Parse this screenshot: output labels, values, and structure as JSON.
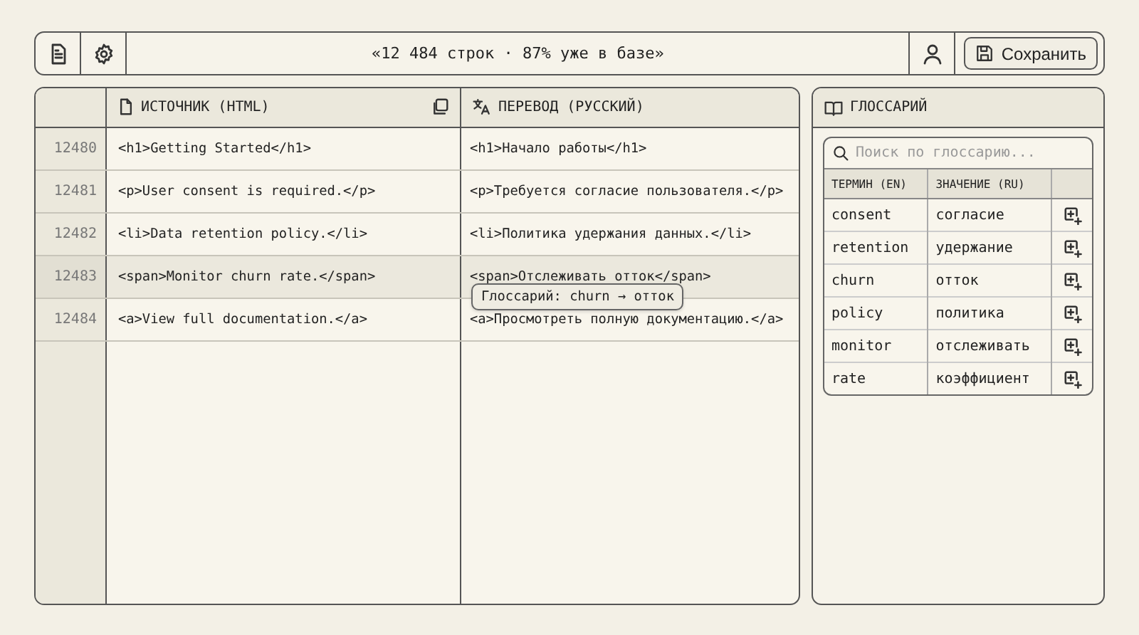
{
  "toolbar": {
    "summary": "«12 484 строк · 87% уже в базе»",
    "save_button": "Сохранить"
  },
  "editor": {
    "columns": [
      "ИСТОЧНИК (HTML)",
      "ПЕРЕВОД (РУССКИЙ)"
    ],
    "rows": [
      {
        "line": "12480",
        "source": "<h1>Getting Started</h1>",
        "translation": "<h1>Начало работы</h1>",
        "selected": false
      },
      {
        "line": "12481",
        "source": "<p>User consent is required.</p>",
        "translation": "<p>Требуется согласие пользователя.</p>",
        "selected": false
      },
      {
        "line": "12482",
        "source": "<li>Data retention policy.</li>",
        "translation": "<li>Политика удержания данных.</li>",
        "selected": false
      },
      {
        "line": "12483",
        "source": "<span>Monitor churn rate.</span>",
        "translation": "<span>Отслеживать отток</span>",
        "selected": true
      },
      {
        "line": "12484",
        "source": "<a>View full documentation.</a>",
        "translation": "<a>Просмотреть полную документацию.</a>",
        "selected": false
      }
    ],
    "tooltip": "Глоссарий: churn → отток"
  },
  "glossary": {
    "title": "ГЛОССАРИЙ",
    "search": {
      "placeholder": "Поиск по глоссарию..."
    },
    "columns": [
      "ТЕРМИН (EN)",
      "ЗНАЧЕНИЕ (RU)"
    ],
    "rows": [
      {
        "term": "consent",
        "meaning": "согласие"
      },
      {
        "term": "retention",
        "meaning": "удержание"
      },
      {
        "term": "churn",
        "meaning": "отток"
      },
      {
        "term": "policy",
        "meaning": "политика"
      },
      {
        "term": "monitor",
        "meaning": "отслеживать"
      },
      {
        "term": "rate",
        "meaning": "коэффициент"
      }
    ]
  }
}
